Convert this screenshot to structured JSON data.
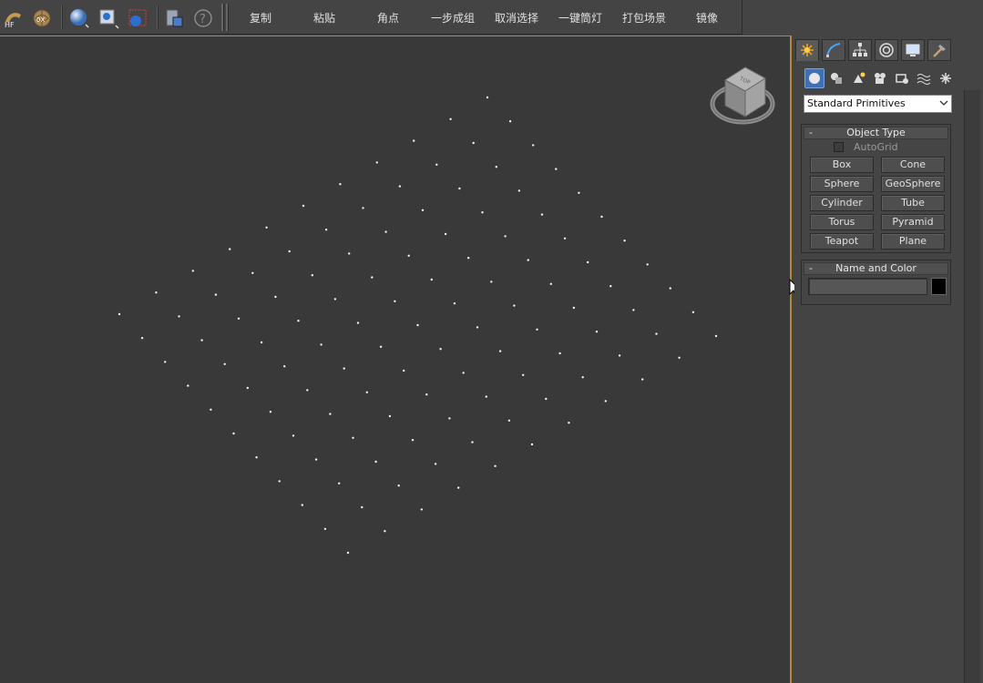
{
  "toolbar": {
    "icons": [
      "hf-icon",
      "walnut-icon",
      "sphere-icon",
      "zoom-scene-icon",
      "render-frame-icon",
      "clipboard-icon",
      "help-icon"
    ],
    "hf_label": "HF",
    "walnut_label": "0X",
    "commands": [
      "复制",
      "粘贴",
      "角点",
      "一步成组",
      "取消选择",
      "一键筒灯",
      "打包场景",
      "镜像"
    ]
  },
  "viewport": {
    "dots_grid": "white-points",
    "viewcube_label": "TOP",
    "border_color": "#b08a3a"
  },
  "command_panel": {
    "tabs": [
      "create-tab",
      "modify-tab",
      "hierarchy-tab",
      "motion-tab",
      "display-tab",
      "utilities-tab"
    ],
    "active_tab": "create-tab",
    "sub_categories": [
      "geometry-icon",
      "shapes-icon",
      "lights-icon",
      "cameras-icon",
      "helpers-icon",
      "space-warps-icon",
      "systems-icon"
    ],
    "category_dropdown": "Standard Primitives",
    "object_type": {
      "title": "Object Type",
      "collapse": "-",
      "autogrid_label": "AutoGrid",
      "buttons": [
        "Box",
        "Cone",
        "Sphere",
        "GeoSphere",
        "Cylinder",
        "Tube",
        "Torus",
        "Pyramid",
        "Teapot",
        "Plane"
      ]
    },
    "name_and_color": {
      "title": "Name and Color",
      "collapse": "-",
      "name_value": "",
      "color": "#000000"
    }
  }
}
